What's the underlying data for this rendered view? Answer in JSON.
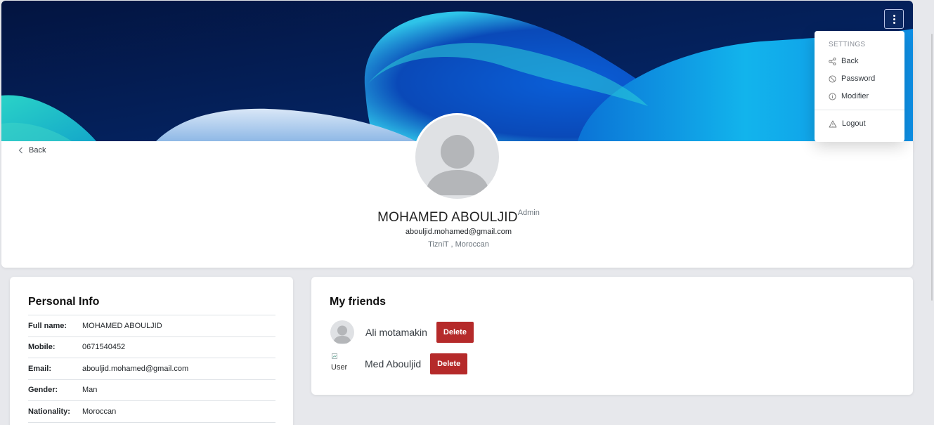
{
  "profile": {
    "name": "MOHAMED ABOULJID",
    "role": "Admin",
    "email": "abouljid.mohamed@gmail.com",
    "location": "TizniT , Moroccan",
    "back_label": "Back"
  },
  "settings_menu": {
    "header": "SETTINGS",
    "items": [
      {
        "label": "Back",
        "icon": "share-icon"
      },
      {
        "label": "Password",
        "icon": "block-icon"
      },
      {
        "label": "Modifier",
        "icon": "info-icon"
      },
      {
        "label": "Logout",
        "icon": "warning-icon"
      }
    ]
  },
  "personal_info": {
    "title": "Personal Info",
    "rows": [
      {
        "key": "Full name:",
        "value": "MOHAMED ABOULJID"
      },
      {
        "key": "Mobile:",
        "value": "0671540452"
      },
      {
        "key": "Email:",
        "value": "abouljid.mohamed@gmail.com"
      },
      {
        "key": "Gender:",
        "value": "Man"
      },
      {
        "key": "Nationality:",
        "value": "Moroccan"
      }
    ]
  },
  "friends": {
    "title": "My friends",
    "items": [
      {
        "name": "Ali motamakin",
        "delete_label": "Delete",
        "avatar_alt": ""
      },
      {
        "name": "Med Abouljid",
        "delete_label": "Delete",
        "avatar_alt": "User"
      }
    ]
  },
  "colors": {
    "delete_button": "#b52a2a",
    "cover_dark": "#031a4d",
    "cover_accent": "#10b5e6"
  }
}
